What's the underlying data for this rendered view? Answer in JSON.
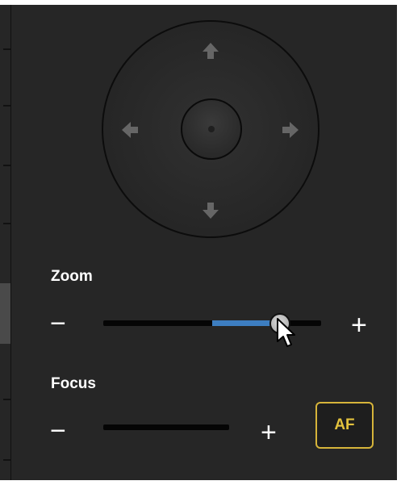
{
  "joystick": {
    "up_icon": "arrow-up-icon",
    "down_icon": "arrow-down-icon",
    "left_icon": "arrow-left-icon",
    "right_icon": "arrow-right-icon",
    "center_icon": "center-knob"
  },
  "zoom": {
    "label": "Zoom",
    "minus": "−",
    "plus": "+",
    "level_fraction": 0.81,
    "fill_color": "#3d7ec1"
  },
  "focus": {
    "label": "Focus",
    "minus": "−",
    "plus": "+",
    "af_label": "AF",
    "af_color": "#e3c23d"
  },
  "colors": {
    "panel_bg": "#262626",
    "text": "#ffffff",
    "accent": "#3d7ec1"
  }
}
